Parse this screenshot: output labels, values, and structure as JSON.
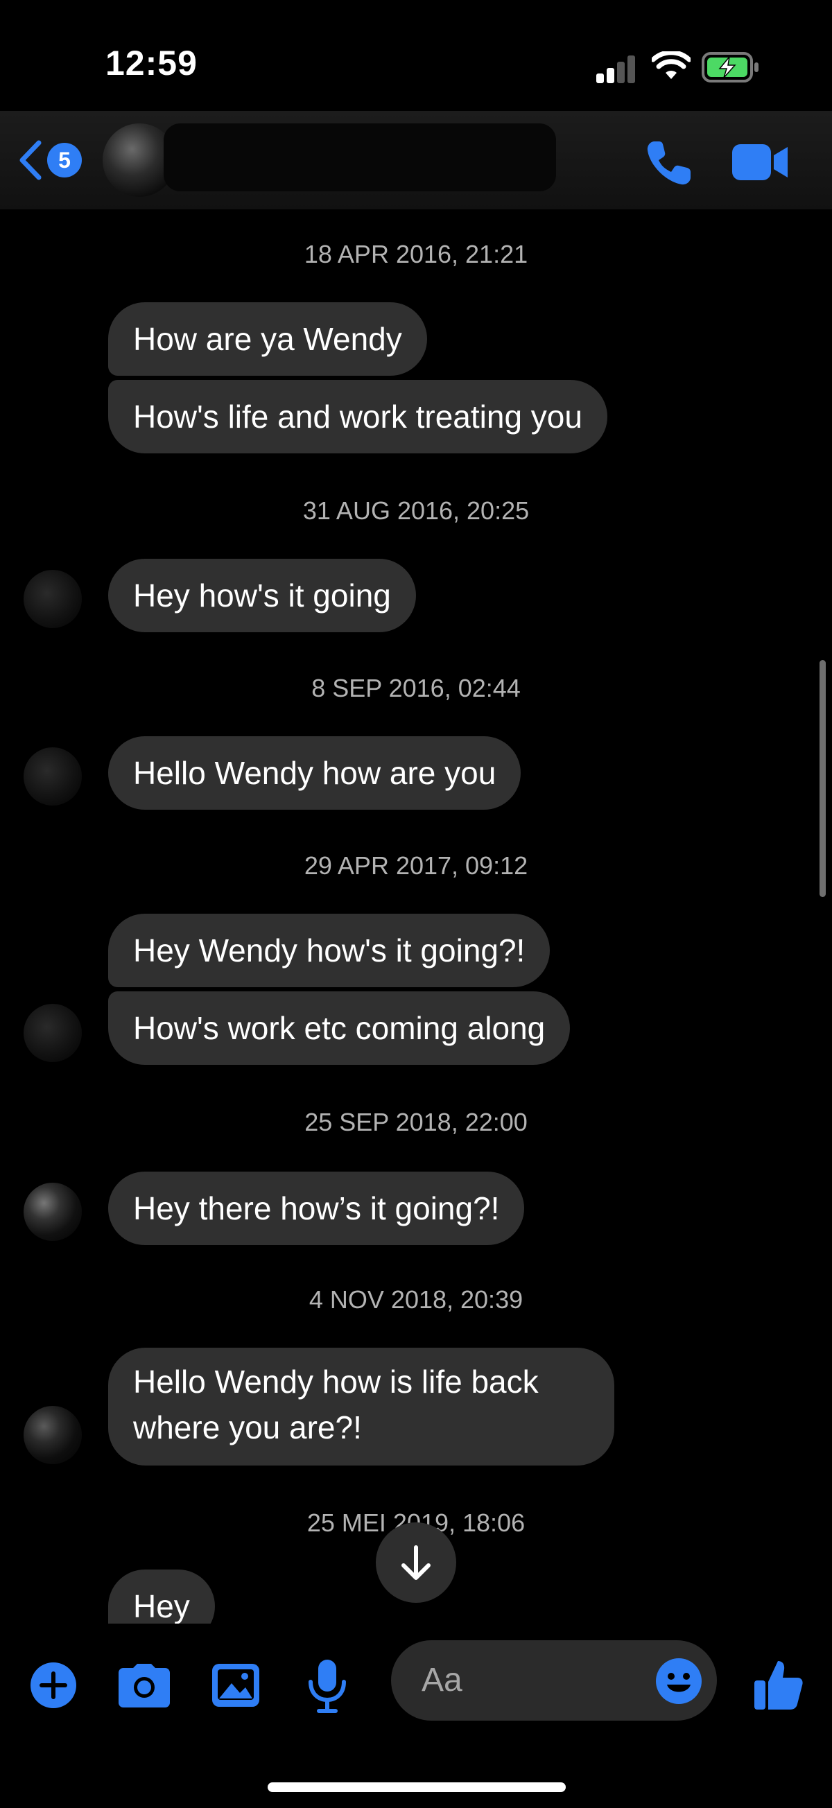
{
  "status_bar": {
    "time": "12:59"
  },
  "header": {
    "back_count": "5"
  },
  "messages": [
    {
      "timestamp": "18 APR 2016, 21:21",
      "bubbles": [
        "How are ya Wendy",
        "How's life and work treating you"
      ]
    },
    {
      "timestamp": "31 AUG 2016, 20:25",
      "bubbles": [
        "Hey how's it going"
      ]
    },
    {
      "timestamp": "8 SEP 2016, 02:44",
      "bubbles": [
        "Hello Wendy how are you"
      ]
    },
    {
      "timestamp": "29 APR 2017, 09:12",
      "bubbles": [
        "Hey Wendy how's it going?!",
        "How's work etc coming along"
      ]
    },
    {
      "timestamp": "25 SEP 2018, 22:00",
      "bubbles": [
        "Hey there how’s it going?!"
      ]
    },
    {
      "timestamp": "4 NOV 2018, 20:39",
      "bubbles": [
        "Hello Wendy how is life back where you are?!"
      ]
    },
    {
      "timestamp": "25 MEI 2019, 18:06",
      "bubbles": [
        "Hey"
      ]
    }
  ],
  "composer": {
    "placeholder": "Aa"
  },
  "colors": {
    "accent": "#2f7ef5",
    "bubble": "#303030",
    "background": "#000000"
  },
  "icons": [
    "back-chevron-icon",
    "phone-icon",
    "video-camera-icon",
    "arrow-down-icon",
    "plus-icon",
    "camera-icon",
    "gallery-icon",
    "microphone-icon",
    "emoji-icon",
    "thumbs-up-icon"
  ]
}
